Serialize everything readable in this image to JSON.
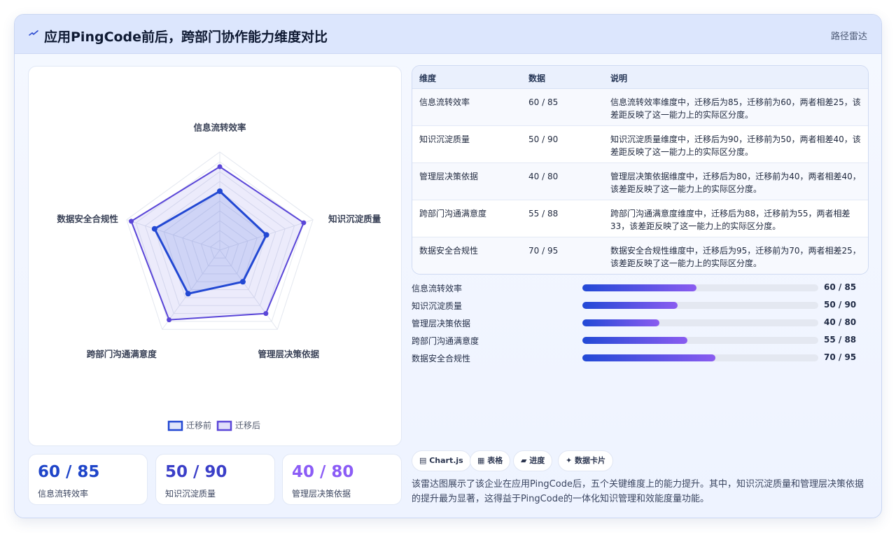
{
  "header": {
    "title": "应用PingCode前后，跨部门协作能力维度对比",
    "tag": "路径雷达"
  },
  "colors": {
    "before": "#2248d3",
    "after": "#5a46d8",
    "accent_purple": "#8b5cf6"
  },
  "chart_data": {
    "type": "radar",
    "axes": [
      "信息流转效率",
      "知识沉淀质量",
      "管理层决策依据",
      "跨部门沟通满意度",
      "数据安全合规性"
    ],
    "range": [
      0,
      100
    ],
    "series": [
      {
        "name": "迁移前",
        "values": [
          60,
          50,
          40,
          55,
          70
        ]
      },
      {
        "name": "迁移后",
        "values": [
          85,
          90,
          80,
          88,
          95
        ]
      }
    ],
    "legend_position": "bottom"
  },
  "table": {
    "headers": [
      "维度",
      "数据",
      "说明"
    ],
    "rows": [
      {
        "dim": "信息流转效率",
        "data": "60 / 85",
        "desc": "信息流转效率维度中，迁移后为85，迁移前为60，两者相差25，该差距反映了这一能力上的实际区分度。"
      },
      {
        "dim": "知识沉淀质量",
        "data": "50 / 90",
        "desc": "知识沉淀质量维度中，迁移后为90，迁移前为50，两者相差40，该差距反映了这一能力上的实际区分度。"
      },
      {
        "dim": "管理层决策依据",
        "data": "40 / 80",
        "desc": "管理层决策依据维度中，迁移后为80，迁移前为40，两者相差40，该差距反映了这一能力上的实际区分度。"
      },
      {
        "dim": "跨部门沟通满意度",
        "data": "55 / 88",
        "desc": "跨部门沟通满意度维度中，迁移后为88，迁移前为55，两者相差33，该差距反映了这一能力上的实际区分度。"
      },
      {
        "dim": "数据安全合规性",
        "data": "70 / 95",
        "desc": "数据安全合规性维度中，迁移后为95，迁移前为70，两者相差25，该差距反映了这一能力上的实际区分度。"
      }
    ]
  },
  "progress": [
    {
      "label": "信息流转效率",
      "value_text": "60 / 85",
      "fraction": 0.485
    },
    {
      "label": "知识沉淀质量",
      "value_text": "50 / 90",
      "fraction": 0.405
    },
    {
      "label": "管理层决策依据",
      "value_text": "40 / 80",
      "fraction": 0.325
    },
    {
      "label": "跨部门沟通满意度",
      "value_text": "55 / 88",
      "fraction": 0.445
    },
    {
      "label": "数据安全合规性",
      "value_text": "70 / 95",
      "fraction": 0.565
    }
  ],
  "stats": [
    {
      "value": "60 / 85",
      "label": "信息流转效率",
      "color": "#1f45c9"
    },
    {
      "value": "50 / 90",
      "label": "知识沉淀质量",
      "color": "#3b3fc8"
    },
    {
      "value": "40 / 80",
      "label": "管理层决策依据",
      "color": "#8b5cf6"
    }
  ],
  "chips": [
    "▤ Chart.js",
    "▦ 表格",
    "▰ 进度",
    "✦ 数据卡片"
  ],
  "summary": "该雷达图展示了该企业在应用PingCode后，五个关键维度上的能力提升。其中，知识沉淀质量和管理层决策依据的提升最为显著，这得益于PingCode的一体化知识管理和效能度量功能。"
}
